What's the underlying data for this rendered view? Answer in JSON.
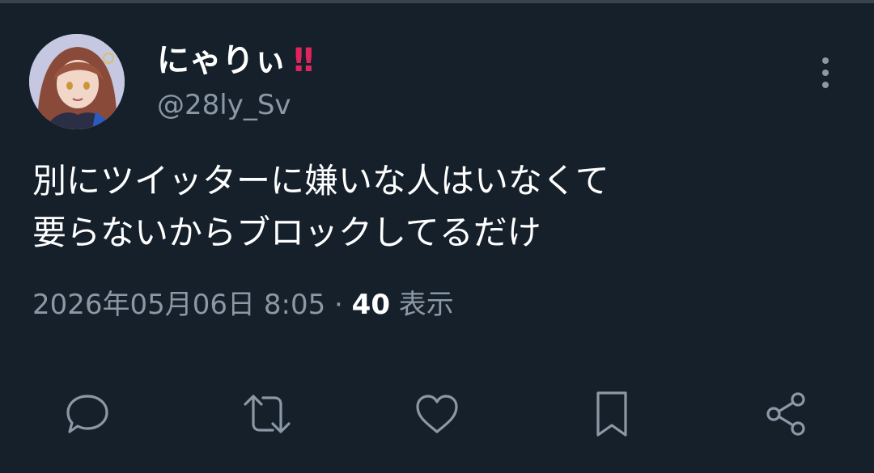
{
  "tweet": {
    "display_name": "にゃりぃ",
    "display_name_emoji": "!!",
    "handle": "@28ly_Sv",
    "text_lines": [
      "別にツイッターに嫌いな人はいなくて",
      "要らないからブロックしてるだけ"
    ],
    "timestamp": "2026年05月06日 8:05",
    "separator": " · ",
    "views_count": "40",
    "views_label": "表示"
  },
  "icons": {
    "more": "more-vertical-icon",
    "reply": "reply-icon",
    "retweet": "retweet-icon",
    "like": "heart-icon",
    "bookmark": "bookmark-icon",
    "share": "share-icon"
  },
  "colors": {
    "background": "#15202b",
    "secondary_text": "#8b98a5",
    "emoji": "#e0245e"
  }
}
